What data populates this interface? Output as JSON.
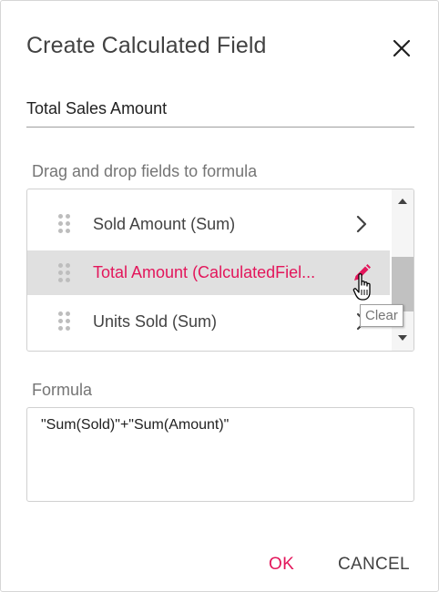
{
  "dialog": {
    "title": "Create Calculated Field",
    "field_name_value": "Total Sales Amount",
    "drag_label": "Drag and drop fields to formula",
    "formula_label": "Formula",
    "formula_value": "\"Sum(Sold)\"+\"Sum(Amount)\""
  },
  "fields": [
    {
      "label": "Sold Amount (Sum)",
      "icon": "chevron-right-icon"
    },
    {
      "label": "Total Amount (CalculatedFiel...",
      "icon": "edit-icon",
      "state": "hovered"
    },
    {
      "label": "Units Sold (Sum)",
      "icon": "chevron-right-icon"
    }
  ],
  "tooltip": {
    "text": "Clear"
  },
  "buttons": {
    "ok": "OK",
    "cancel": "CANCEL"
  },
  "colors": {
    "accent": "#e3165b",
    "active_row": "#e0e0e0",
    "text": "#424242"
  }
}
